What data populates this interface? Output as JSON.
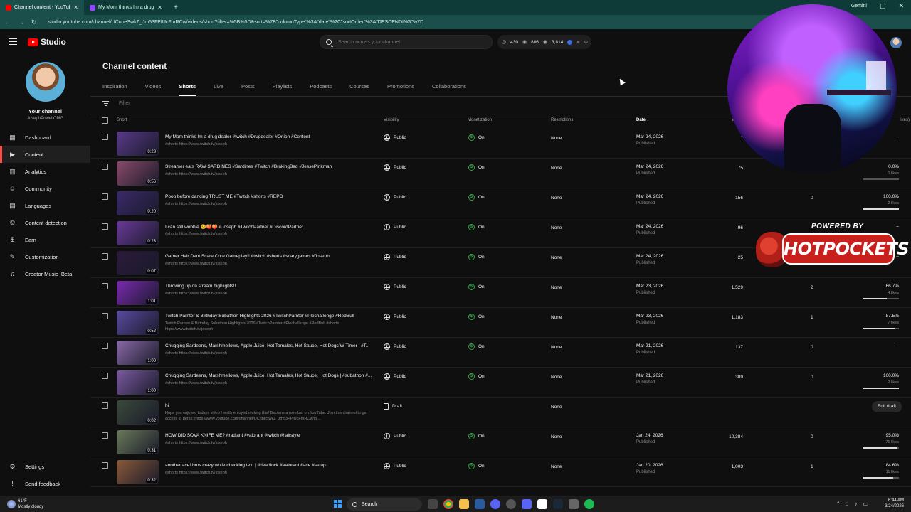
{
  "browser": {
    "tabs": [
      {
        "title": "Channel content - YouTube Studio",
        "active": true
      },
      {
        "title": "My Mom thinks Im a drug dealer",
        "active": false
      }
    ],
    "gemini": "Gemini",
    "url": "studio.youtube.com/channel/UCnbeSwkZ_Jm53FPfUcFmRCw/videos/short?filter=%5B%5D&sort=%7B\"columnType\"%3A\"date\"%2C\"sortOrder\"%3A\"DESCENDING\"%7D"
  },
  "header": {
    "logo_text": "Studio",
    "search_placeholder": "Search across your channel",
    "stats": [
      "430",
      "806",
      "3,814"
    ]
  },
  "sidebar": {
    "channel_label": "Your channel",
    "handle": "JosephPowellOMG",
    "items": [
      {
        "label": "Dashboard",
        "icon": "dashboard-icon",
        "active": false
      },
      {
        "label": "Content",
        "icon": "content-icon",
        "active": true
      },
      {
        "label": "Analytics",
        "icon": "analytics-icon",
        "active": false
      },
      {
        "label": "Community",
        "icon": "community-icon",
        "active": false
      },
      {
        "label": "Languages",
        "icon": "languages-icon",
        "active": false
      },
      {
        "label": "Content detection",
        "icon": "copyright-icon",
        "active": false
      },
      {
        "label": "Earn",
        "icon": "earn-icon",
        "active": false
      },
      {
        "label": "Customization",
        "icon": "customization-icon",
        "active": false
      },
      {
        "label": "Creator Music [Beta]",
        "icon": "music-icon",
        "active": false
      }
    ],
    "bottom": [
      {
        "label": "Settings",
        "icon": "gear-icon"
      },
      {
        "label": "Send feedback",
        "icon": "feedback-icon"
      }
    ]
  },
  "main": {
    "title": "Channel content",
    "tabs": [
      "Inspiration",
      "Videos",
      "Shorts",
      "Live",
      "Posts",
      "Playlists",
      "Podcasts",
      "Courses",
      "Promotions",
      "Collaborations"
    ],
    "active_tab": "Shorts",
    "filter_placeholder": "Filter",
    "columns": {
      "short": "Short",
      "visibility": "Visibility",
      "monetization": "Monetization",
      "restrictions": "Restrictions",
      "date": "Date",
      "views": "V",
      "likes": "likes)"
    },
    "rows": [
      {
        "title": "My Mom thinks Im a drug dealer #twitch #Drugdealer #Onion #Content",
        "desc": "#shorts https://www.twitch.tv/joseph",
        "dur": "0:23",
        "vis": "Public",
        "mon": "On",
        "restr": "None",
        "date": "Mar 24, 2026",
        "status": "Published",
        "views": "1",
        "comments": "",
        "likes": "–",
        "likes_sub": "",
        "bar": null,
        "thumb": "#5a3a8a"
      },
      {
        "title": "Streamer eats RAW SARDINES #Sardines #Twitch #BrakingBad #JessePinkman",
        "desc": "#shorts https://www.twitch.tv/joseph",
        "dur": "0:56",
        "vis": "Public",
        "mon": "On",
        "restr": "None",
        "date": "Mar 24, 2026",
        "status": "Published",
        "views": "75",
        "comments": "",
        "likes": "0.0%",
        "likes_sub": "0 likes",
        "bar": 0.0,
        "thumb": "#8a4a6a"
      },
      {
        "title": "Poop before dancing TRUST ME #Twitch #shorts #REPO",
        "desc": "#shorts https://www.twitch.tv/joseph",
        "dur": "0:20",
        "vis": "Public",
        "mon": "On",
        "restr": "None",
        "date": "Mar 24, 2026",
        "status": "Published",
        "views": "156",
        "comments": "0",
        "likes": "100.0%",
        "likes_sub": "2 likes",
        "bar": 1.0,
        "thumb": "#3a2a6a"
      },
      {
        "title": "I can still wobble 😵🍑🍑 #Joseph #TwitchPartner #DiscordPartner",
        "desc": "#shorts https://www.twitch.tv/joseph",
        "dur": "0:23",
        "vis": "Public",
        "mon": "On",
        "restr": "None",
        "date": "Mar 24, 2026",
        "status": "Published",
        "views": "96",
        "comments": "",
        "likes": "–",
        "likes_sub": "",
        "bar": null,
        "thumb": "#6a3a9a"
      },
      {
        "title": "Gamer Hair Dent Scare Core Gameplay!! #twitch #shorts #scarygames #Joseph",
        "desc": "#shorts https://www.twitch.tv/joseph",
        "dur": "0:07",
        "vis": "Public",
        "mon": "On",
        "restr": "None",
        "date": "Mar 24, 2026",
        "status": "Published",
        "views": "25",
        "comments": "",
        "likes": "–",
        "likes_sub": "",
        "bar": null,
        "thumb": "#2a1a3a"
      },
      {
        "title": "Throwing up on stream highlights!!",
        "desc": "#shorts https://www.twitch.tv/joseph",
        "dur": "1:01",
        "vis": "Public",
        "mon": "On",
        "restr": "None",
        "date": "Mar 23, 2026",
        "status": "Published",
        "views": "1,529",
        "comments": "2",
        "likes": "66.7%",
        "likes_sub": "4 likes",
        "bar": 0.667,
        "thumb": "#7a2ab0"
      },
      {
        "title": "Twitch Parnter & Birthday Subathon Highlights 2026 #TwitchParnter #Plechallenge #RedBull",
        "desc": "Twitch Parnter & Birthday Subathon Highlights 2026 #TwitchParnter #Plechallenge #RedBull #shorts https://www.twitch.tv/joseph",
        "dur": "0:52",
        "vis": "Public",
        "mon": "On",
        "restr": "None",
        "date": "Mar 23, 2026",
        "status": "Published",
        "views": "1,183",
        "comments": "1",
        "likes": "87.5%",
        "likes_sub": "7 likes",
        "bar": 0.875,
        "thumb": "#5a4aa0"
      },
      {
        "title": "Chugging Sardeens, Marshmellows, Apple Juice, Hot Tamales, Hot Sauce, Hot Dogs W Timer | #T...",
        "desc": "#shorts https://www.twitch.tv/joseph",
        "dur": "1:00",
        "vis": "Public",
        "mon": "On",
        "restr": "None",
        "date": "Mar 21, 2026",
        "status": "Published",
        "views": "137",
        "comments": "0",
        "likes": "–",
        "likes_sub": "",
        "bar": null,
        "thumb": "#8a6aa8"
      },
      {
        "title": "Chugging Sardeens, Marshmellows, Apple Juice, Hot Tamales, Hot Sauce, Hot Dogs | #subathon #...",
        "desc": "#shorts https://www.twitch.tv/joseph",
        "dur": "1:00",
        "vis": "Public",
        "mon": "On",
        "restr": "None",
        "date": "Mar 21, 2026",
        "status": "Published",
        "views": "389",
        "comments": "0",
        "likes": "100.0%",
        "likes_sub": "2 likes",
        "bar": 1.0,
        "thumb": "#7a5aa0"
      },
      {
        "title": "hi",
        "desc": "Hope you enjoyed todays video I really enjoyed making this! Become a member on YouTube. Join this channel to get access to perks: https://www.youtube.com/channel/UCnbeSwkZ_Jm53FPfUcFmRCw/joi...",
        "dur": "0:02",
        "vis": "Draft",
        "mon": "",
        "restr": "None",
        "date": "",
        "status": "",
        "views": "",
        "comments": "",
        "likes": "",
        "likes_sub": "",
        "bar": null,
        "draft": true,
        "edit_label": "Edit draft",
        "thumb": "#3a4a3a"
      },
      {
        "title": "HOW DID SOVA KNIFE ME? #radiant #valorant #twitch #hairstyle",
        "desc": "#shorts https://www.twitch.tv/joseph",
        "dur": "0:31",
        "vis": "Public",
        "mon": "On",
        "restr": "None",
        "date": "Jan 24, 2026",
        "status": "Published",
        "views": "10,384",
        "comments": "0",
        "likes": "95.0%",
        "likes_sub": "76 likes",
        "bar": 0.95,
        "thumb": "#6a7a5a"
      },
      {
        "title": "another ace! bros crazy while checking text | #deadlock #Valorant #ace #setup",
        "desc": "#shorts https://www.twitch.tv/joseph",
        "dur": "0:32",
        "vis": "Public",
        "mon": "On",
        "restr": "None",
        "date": "Jan 20, 2026",
        "status": "Published",
        "views": "1,003",
        "comments": "1",
        "likes": "84.6%",
        "likes_sub": "11 likes",
        "bar": 0.846,
        "thumb": "#8a5a3a"
      }
    ]
  },
  "overlay": {
    "powered_by": "POWERED BY",
    "brand": "HOTPOCKETS"
  },
  "taskbar": {
    "temp": "61°F",
    "weather": "Mostly cloudy",
    "search": "Search",
    "time": "6:44 AM",
    "date": "3/24/2026"
  },
  "colors": {
    "accent_red": "#ff4e45",
    "monetization_green": "#2ba640",
    "browser_teal": "#1b4f4c"
  }
}
